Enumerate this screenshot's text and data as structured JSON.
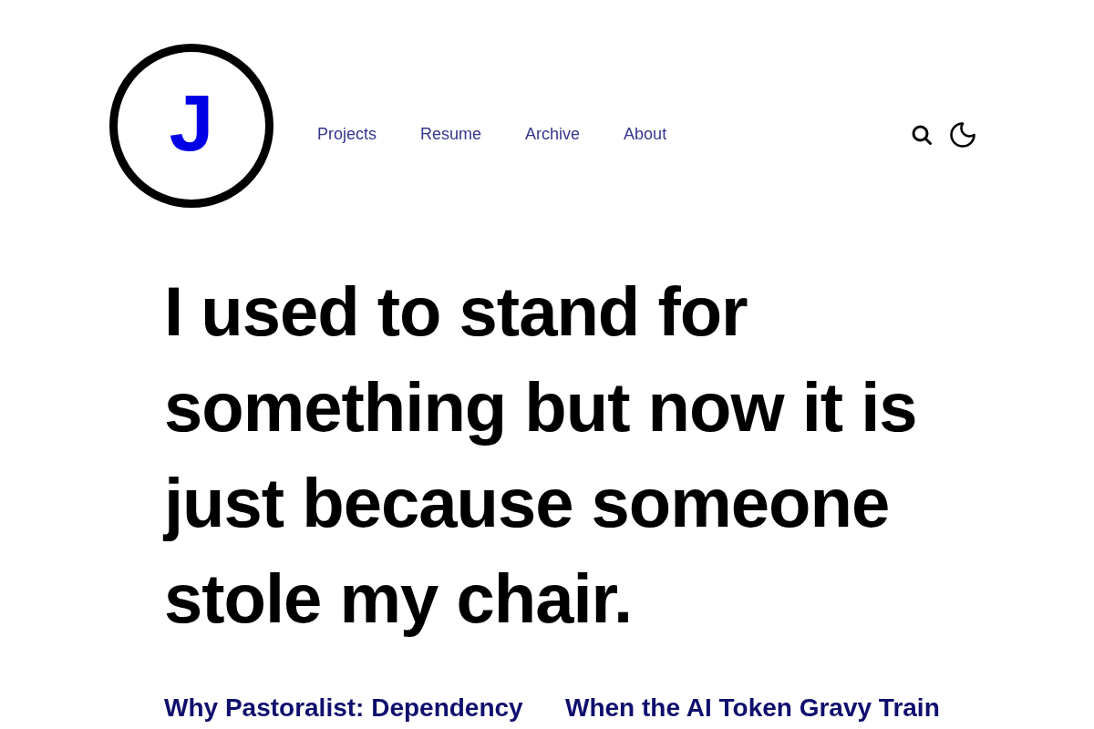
{
  "logo": {
    "letter": "J"
  },
  "nav": [
    {
      "label": "Projects"
    },
    {
      "label": "Resume"
    },
    {
      "label": "Archive"
    },
    {
      "label": "About"
    }
  ],
  "headline": "I used to stand for something but now it is just because someone stole my chair.",
  "posts": [
    {
      "title": "Why Pastoralist: Dependency"
    },
    {
      "title": "When the AI Token Gravy Train"
    }
  ]
}
